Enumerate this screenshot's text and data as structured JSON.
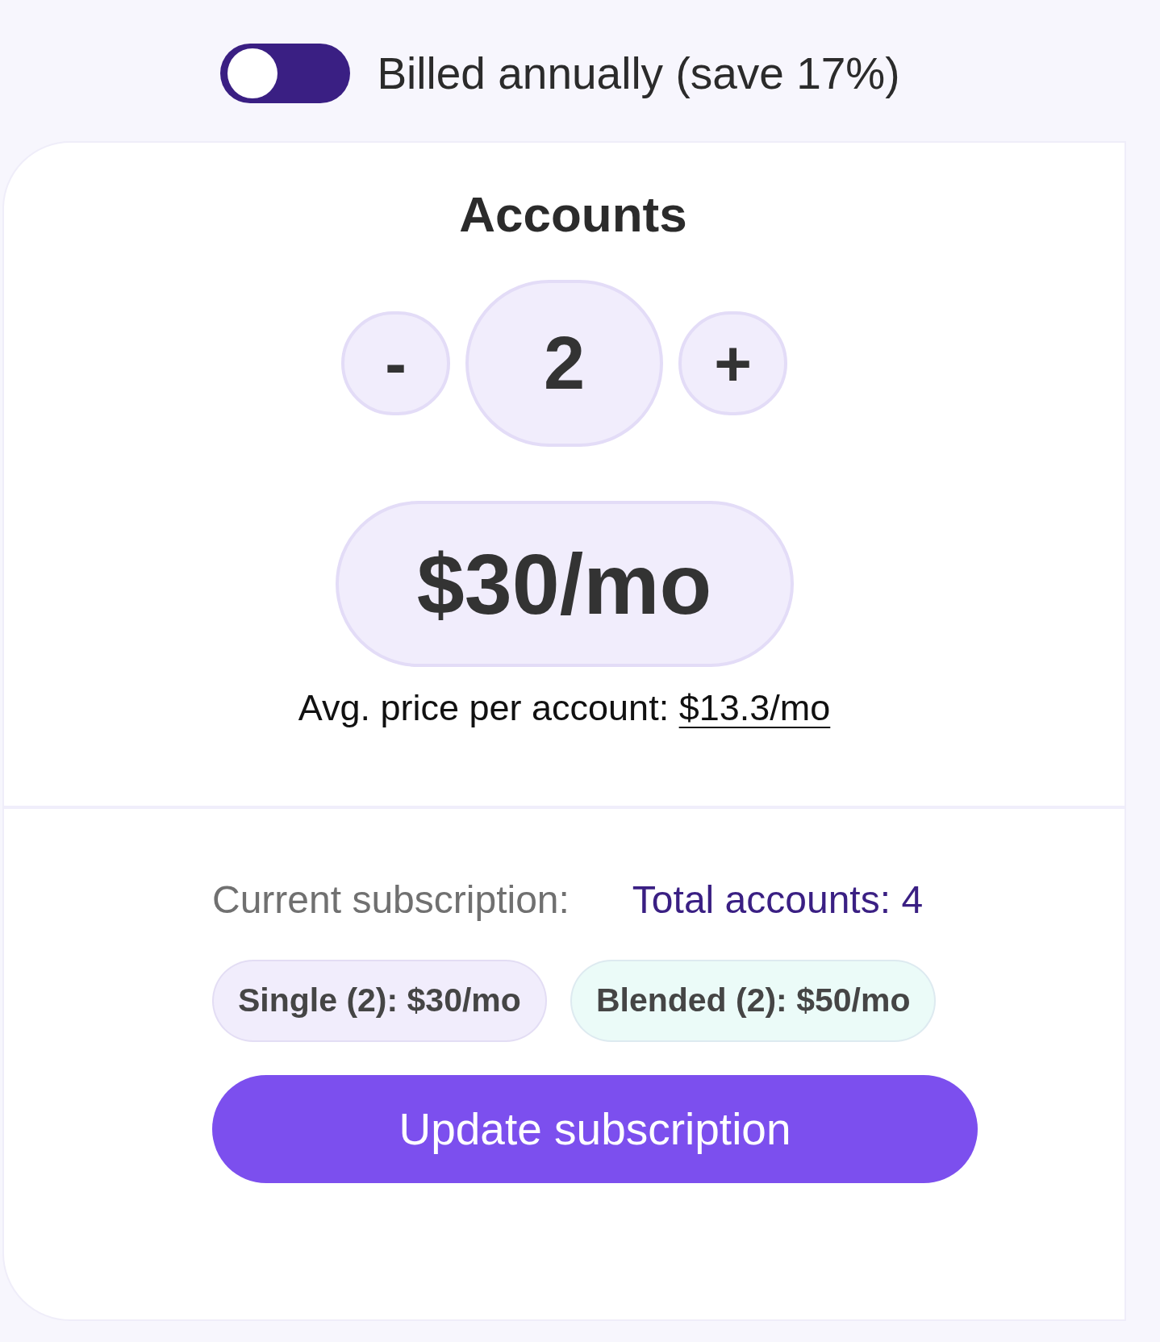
{
  "billing": {
    "label": "Billed annually (save 17%)",
    "on": false
  },
  "accounts": {
    "title": "Accounts",
    "decrement": "-",
    "count": "2",
    "increment": "+",
    "price": "$30/mo",
    "avg_label": "Avg. price per account:",
    "avg_value": "$13.3/mo"
  },
  "subscription": {
    "label": "Current subscription:",
    "total": "Total accounts: 4",
    "chips": [
      {
        "label": "Single (2): $30/mo",
        "color": "#f1edfc"
      },
      {
        "label": "Blended (2): $50/mo",
        "color": "#ebfbf8"
      }
    ],
    "button": "Update subscription"
  }
}
